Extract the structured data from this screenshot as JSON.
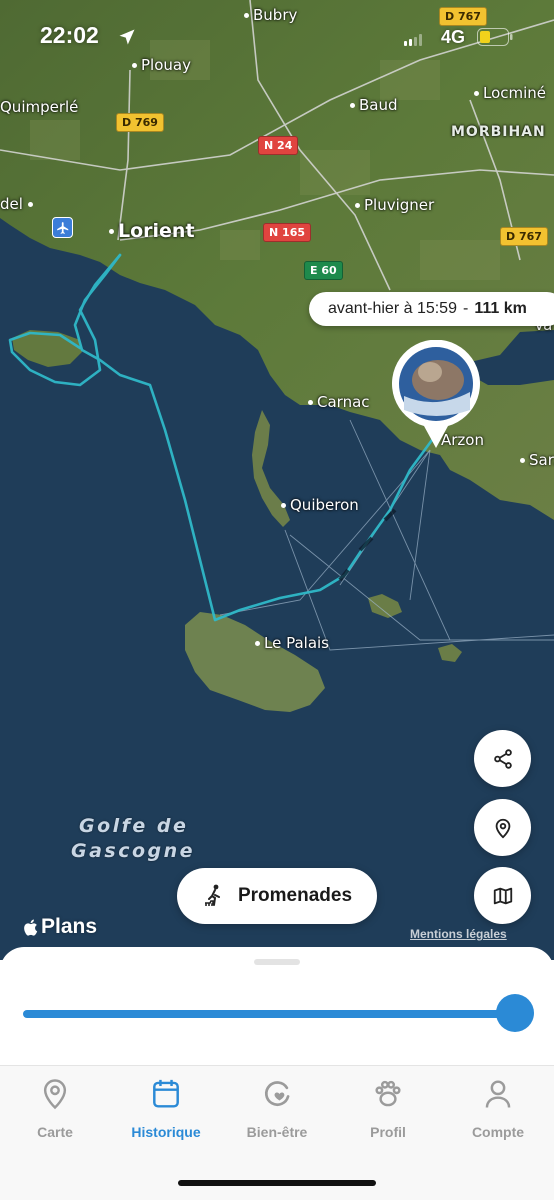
{
  "status_bar": {
    "time": "22:02",
    "network": "4G",
    "battery_color": "#f2d21b"
  },
  "map": {
    "places": {
      "bubry": "Bubry",
      "plouay": "Plouay",
      "quimperle": "Quimperlé",
      "baud": "Baud",
      "locmine": "Locminé",
      "morbihan": "MORBIHAN",
      "del": "del",
      "pluvigner": "Pluvigner",
      "lorient": "Lorient",
      "carnac": "Carnac",
      "arzon": "Arzon",
      "sarz": "Sarz",
      "quiberon": "Quiberon",
      "le_palais": "Le Palais",
      "va": "Va"
    },
    "sea_label_line1": "Golfe de",
    "sea_label_line2": "Gascogne",
    "roads": {
      "d767_top": "D 767",
      "d769": "D 769",
      "n24": "N 24",
      "n165": "N 165",
      "e60": "E 60",
      "d767_right": "D 767"
    },
    "track_color": "#2fb8c8"
  },
  "tooltip": {
    "when": "avant-hier à 15:59",
    "separator": "-",
    "distance": "111 km"
  },
  "buttons": {
    "share_icon": "share-icon",
    "location_icon": "location-pin-icon",
    "map_icon": "map-icon",
    "promenades_label": "Promenades"
  },
  "attribution": {
    "brand": "Plans",
    "legal": "Mentions légales"
  },
  "slider": {
    "value": 1.0,
    "color": "#2b8ad6"
  },
  "tabs": [
    {
      "label": "Carte",
      "icon": "location-pin-icon",
      "active": false
    },
    {
      "label": "Historique",
      "icon": "calendar-icon",
      "active": true
    },
    {
      "label": "Bien-être",
      "icon": "heart-cycle-icon",
      "active": false
    },
    {
      "label": "Profil",
      "icon": "paw-icon",
      "active": false
    },
    {
      "label": "Compte",
      "icon": "person-icon",
      "active": false
    }
  ]
}
